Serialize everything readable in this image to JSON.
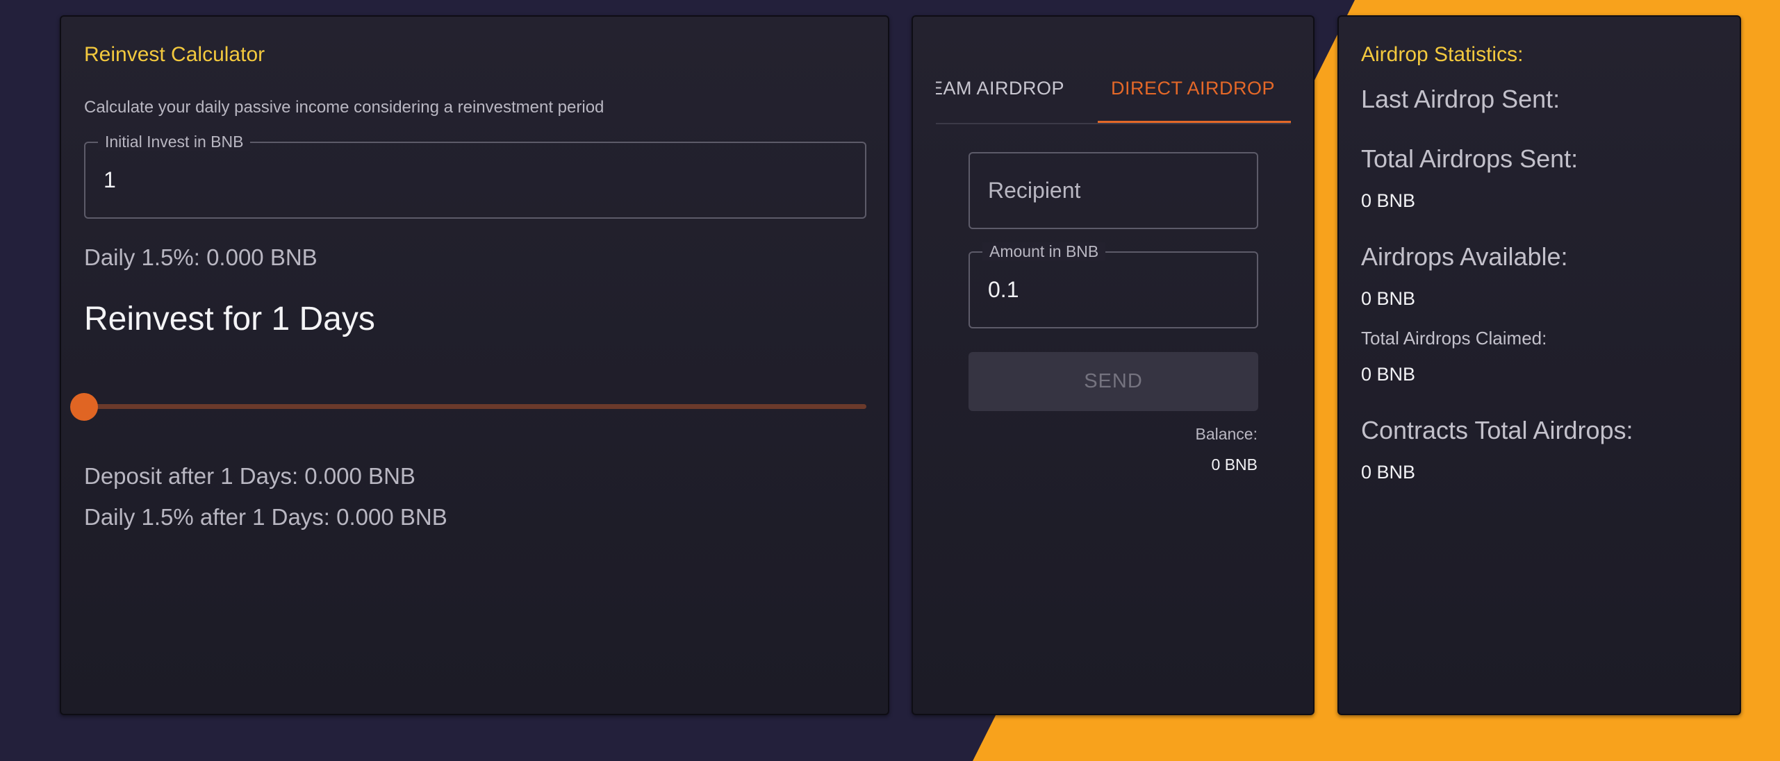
{
  "colors": {
    "background": "#23203b",
    "accent_orange": "#f8a21c",
    "title_yellow": "#f3c93e",
    "tab_active": "#e46828"
  },
  "calculator": {
    "title": "Reinvest Calculator",
    "description": "Calculate your daily passive income considering a reinvestment period",
    "invest_label": "Initial Invest in BNB",
    "invest_value": "1",
    "daily_text": "Daily 1.5%: 0.000 BNB",
    "reinvest_heading": "Reinvest for 1 Days",
    "slider_fraction": 0,
    "deposit_after": "Deposit after 1 Days: 0.000 BNB",
    "daily_after": "Daily 1.5% after 1 Days: 0.000 BNB"
  },
  "airdrop": {
    "tabs": [
      {
        "label": "EAM AIRDROP",
        "active": false
      },
      {
        "label": "DIRECT AIRDROP",
        "active": true
      }
    ],
    "recipient_placeholder": "Recipient",
    "amount_label": "Amount in BNB",
    "amount_value": "0.1",
    "send_label": "SEND",
    "balance_label": "Balance:",
    "balance_value": "0 BNB"
  },
  "stats": {
    "title": "Airdrop Statistics:",
    "last_sent_label": "Last Airdrop Sent:",
    "total_sent_label": "Total Airdrops Sent:",
    "total_sent_value": "0 BNB",
    "available_label": "Airdrops Available:",
    "available_value": "0 BNB",
    "claimed_label": "Total Airdrops Claimed:",
    "claimed_value": "0 BNB",
    "contracts_label": "Contracts Total Airdrops:",
    "contracts_value": "0 BNB"
  }
}
